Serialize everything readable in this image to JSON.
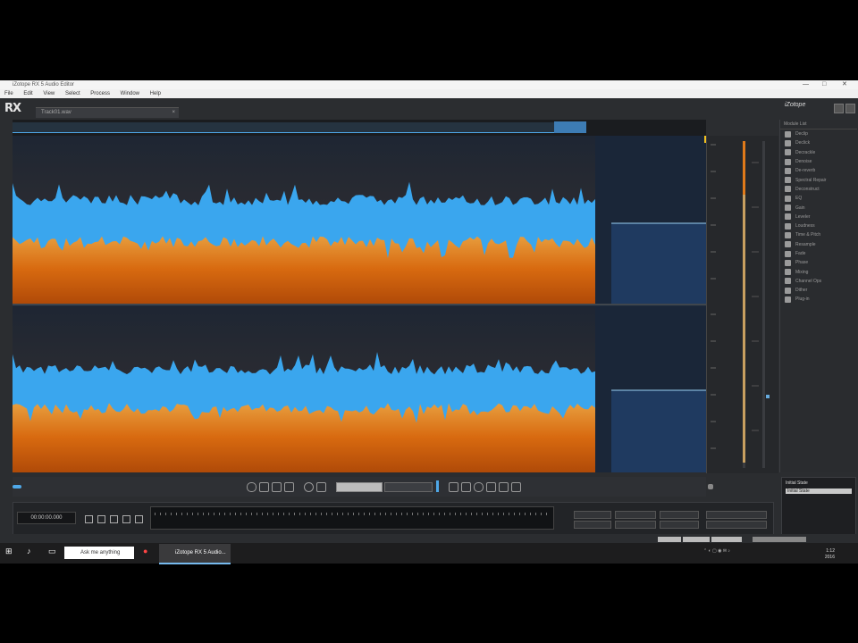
{
  "window": {
    "title": "iZotope RX 5 Audio Editor",
    "controls": [
      "—",
      "□",
      "✕"
    ]
  },
  "menu": [
    "File",
    "Edit",
    "View",
    "Select",
    "Process",
    "Window",
    "Help"
  ],
  "app": {
    "logo": "RX",
    "brand": "iZotope",
    "file_tab": "Track01.wav"
  },
  "modules": {
    "header": "Module List",
    "items": [
      {
        "label": "Declip",
        "icon": "declip-icon"
      },
      {
        "label": "Declick",
        "icon": "declick-icon"
      },
      {
        "label": "Decrackle",
        "icon": "decrackle-icon"
      },
      {
        "label": "Denoise",
        "icon": "denoise-icon"
      },
      {
        "label": "De-reverb",
        "icon": "dereverb-icon"
      },
      {
        "label": "Spectral Repair",
        "icon": "spectral-repair-icon"
      },
      {
        "label": "Deconstruct",
        "icon": "deconstruct-icon"
      },
      {
        "label": "EQ",
        "icon": "eq-icon"
      },
      {
        "label": "Gain",
        "icon": "gain-icon"
      },
      {
        "label": "Leveler",
        "icon": "leveler-icon"
      },
      {
        "label": "Loudness",
        "icon": "loudness-icon"
      },
      {
        "label": "Time & Pitch",
        "icon": "time-pitch-icon"
      },
      {
        "label": "Resample",
        "icon": "resample-icon"
      },
      {
        "label": "Fade",
        "icon": "fade-icon"
      },
      {
        "label": "Phase",
        "icon": "phase-icon"
      },
      {
        "label": "Mixing",
        "icon": "mixing-icon"
      },
      {
        "label": "Channel Ops",
        "icon": "channel-ops-icon"
      },
      {
        "label": "Dither",
        "icon": "dither-icon"
      },
      {
        "label": "Plug-in",
        "icon": "plugin-icon"
      }
    ]
  },
  "history": {
    "label": "Initial State",
    "selected": "Initial State"
  },
  "transport": {
    "time_display": "00:00:00.000"
  },
  "taskbar": {
    "search_placeholder": "Ask me anything",
    "app_button": "iZotope RX 5 Audio...",
    "clock_time": "1:12",
    "clock_date": "2016"
  },
  "colors": {
    "waveform": "#3aa6ee",
    "spectral_orange": "#e07a1a",
    "background_dark": "#1c2a3c",
    "selection": "#4fa8e8"
  }
}
